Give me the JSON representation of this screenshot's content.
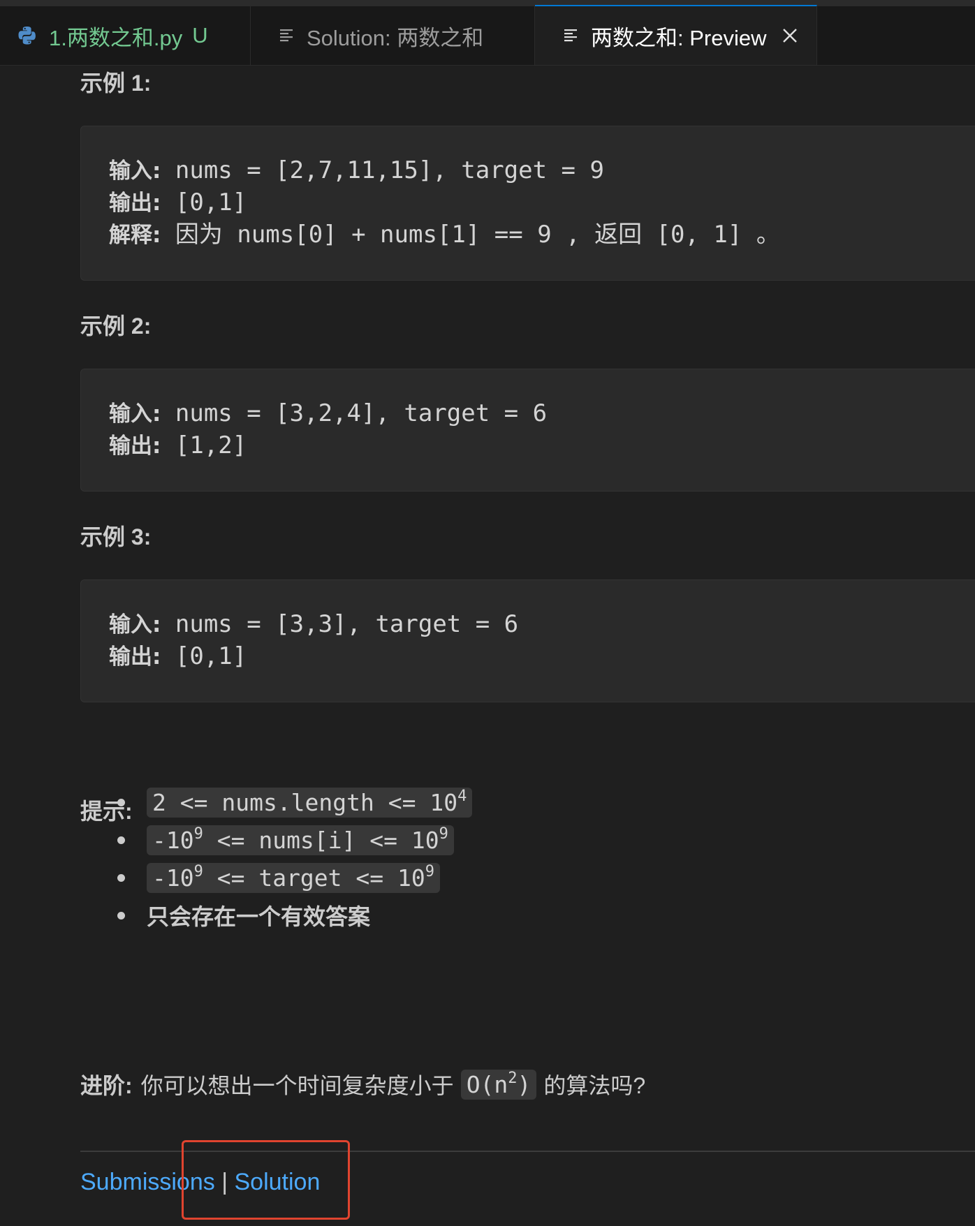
{
  "tabs": [
    {
      "label": "1.两数之和.py",
      "status": "U",
      "icon": "python-icon"
    },
    {
      "label": "Solution: 两数之和",
      "icon": "preview-doc-icon"
    },
    {
      "label": "两数之和: Preview",
      "icon": "preview-doc-icon",
      "active": true
    }
  ],
  "examples": [
    {
      "heading": "示例 1:",
      "lines": [
        {
          "key": "输入:",
          "value": " nums = [2,7,11,15], target = 9"
        },
        {
          "key": "输出:",
          "value": " [0,1]"
        },
        {
          "key": "解释:",
          "value": " 因为 nums[0] + nums[1] == 9 , 返回 [0, 1] 。"
        }
      ]
    },
    {
      "heading": "示例 2:",
      "lines": [
        {
          "key": "输入:",
          "value": " nums = [3,2,4], target = 6"
        },
        {
          "key": "输出:",
          "value": " [1,2]"
        }
      ]
    },
    {
      "heading": "示例 3:",
      "lines": [
        {
          "key": "输入:",
          "value": " nums = [3,3], target = 6"
        },
        {
          "key": "输出:",
          "value": " [0,1]"
        }
      ]
    }
  ],
  "hints": {
    "heading": "提示:",
    "items": [
      {
        "pre": "2 <= nums.length <= 10",
        "sup": "4"
      },
      {
        "pre": "-10",
        "sup": "9",
        "mid": " <= nums[i] <= 10",
        "sup2": "9"
      },
      {
        "pre": "-10",
        "sup": "9",
        "mid": " <= target <= 10",
        "sup2": "9"
      },
      {
        "text": "只会存在一个有效答案"
      }
    ]
  },
  "advance": {
    "label": "进阶:",
    "text_before": "你可以想出一个时间复杂度小于",
    "code": "O(n",
    "code_sup": "2",
    "code_after": ")",
    "text_after": "的算法吗?"
  },
  "footer": {
    "submissions_label": "Submissions",
    "separator": "|",
    "solution_label": "Solution"
  },
  "colors": {
    "background": "#1f1f1f",
    "link": "#4daafc",
    "highlight_box": "#e0442f",
    "modified_file": "#73c991",
    "active_tab_border": "#0078d4"
  }
}
